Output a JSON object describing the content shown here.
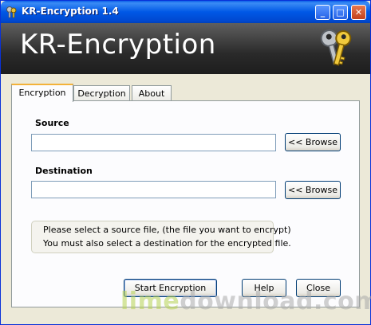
{
  "window": {
    "title": "KR-Encryption 1.4",
    "controls": {
      "minimize": "_",
      "maximize": "□",
      "close": "✕"
    }
  },
  "banner": {
    "title": "KR-Encryption",
    "icon": "keys-icon"
  },
  "tabs": [
    {
      "label": "Encryption",
      "active": true
    },
    {
      "label": "Decryption",
      "active": false
    },
    {
      "label": "About",
      "active": false
    }
  ],
  "encryption": {
    "source": {
      "label": "Source",
      "value": "",
      "browse_label": "<< Browse"
    },
    "destination": {
      "label": "Destination",
      "value": "",
      "browse_label": "<< Browse"
    },
    "info": {
      "line1": "Please select a source file, (the file you want to encrypt)",
      "line2": "You must also select a destination for the encrypted file."
    },
    "buttons": {
      "start": "Start Encryption",
      "help": "Help",
      "close": "Close"
    }
  },
  "watermark": {
    "part1": "lime",
    "part2": "download.com"
  },
  "colors": {
    "titlebar": "#0058e6",
    "banner": "#2a2a2a",
    "face": "#ece9d8",
    "tab_highlight": "#f3b23a"
  }
}
